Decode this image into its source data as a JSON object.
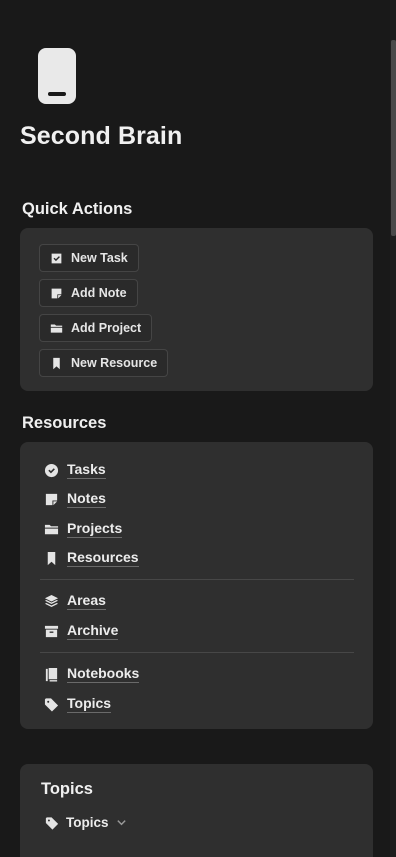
{
  "page": {
    "title": "Second Brain",
    "icon": "phone-icon"
  },
  "quick_actions": {
    "heading": "Quick Actions",
    "buttons": [
      {
        "label": "New Task",
        "icon": "checkbox-icon"
      },
      {
        "label": "Add Note",
        "icon": "note-icon"
      },
      {
        "label": "Add Project",
        "icon": "folder-icon"
      },
      {
        "label": "New Resource",
        "icon": "bookmark-icon"
      }
    ]
  },
  "resources": {
    "heading": "Resources",
    "items": [
      {
        "label": "Tasks",
        "icon": "check-circle-icon"
      },
      {
        "label": "Notes",
        "icon": "note-icon"
      },
      {
        "label": "Projects",
        "icon": "folder-icon"
      },
      {
        "label": "Resources",
        "icon": "bookmark-icon"
      },
      {
        "label": "Areas",
        "icon": "layers-icon"
      },
      {
        "label": "Archive",
        "icon": "archive-icon"
      },
      {
        "label": "Notebooks",
        "icon": "notebook-icon"
      },
      {
        "label": "Topics",
        "icon": "tag-icon"
      }
    ]
  },
  "topics": {
    "heading": "Topics",
    "filter_label": "Topics"
  },
  "colors": {
    "background": "#191919",
    "card": "#2f2f2f",
    "text": "#ececec"
  }
}
